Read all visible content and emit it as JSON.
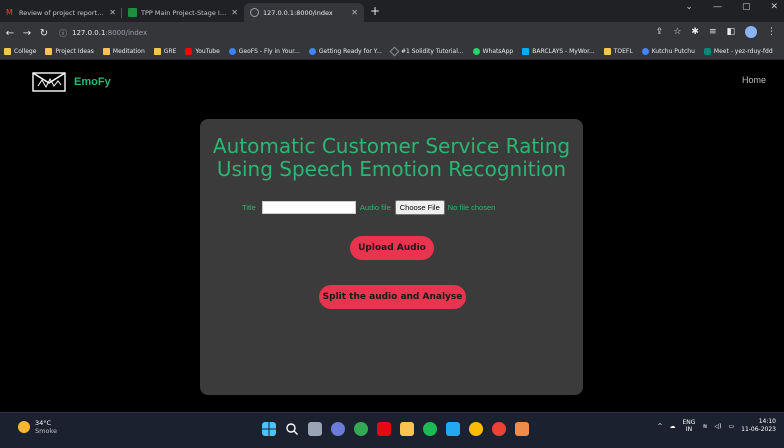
{
  "browser": {
    "tabs": [
      {
        "title": "Review of project report - mihir.",
        "icon": "gmail-icon",
        "color": "#ea4335",
        "active": false
      },
      {
        "title": "TPP Main Project-Stage II- Sem V",
        "icon": "classroom-icon",
        "color": "#1e8e3e",
        "active": false
      },
      {
        "title": "127.0.0.1:8000/index",
        "icon": "globe-icon",
        "color": "#9aa0a6",
        "active": true
      }
    ],
    "new_tab": "+",
    "address": {
      "host": "127.0.0.1",
      "path": ":8000/index"
    },
    "bookmarks": [
      {
        "label": "College",
        "icon": "folder-icon",
        "color": "#f6c44f"
      },
      {
        "label": "Project Ideas",
        "icon": "folder-icon",
        "color": "#f6c44f"
      },
      {
        "label": "Meditation",
        "icon": "folder-icon",
        "color": "#f6c44f"
      },
      {
        "label": "GRE",
        "icon": "folder-icon",
        "color": "#f6c44f"
      },
      {
        "label": "YouTube",
        "icon": "youtube-icon",
        "color": "#ff0000"
      },
      {
        "label": "GeoFS - Fly in Your...",
        "icon": "geofs-icon",
        "color": "#3b82f6"
      },
      {
        "label": "Getting Ready for Y...",
        "icon": "chrome-icon",
        "color": "#4285f4"
      },
      {
        "label": "#1 Solidity Tutorial...",
        "icon": "solidity-icon",
        "color": "#8a8a8a"
      },
      {
        "label": "WhatsApp",
        "icon": "whatsapp-icon",
        "color": "#25d366"
      },
      {
        "label": "BARCLAYS - MyWor...",
        "icon": "barclays-icon",
        "color": "#00aeef"
      },
      {
        "label": "TOEFL",
        "icon": "folder-icon",
        "color": "#f6c44f"
      },
      {
        "label": "Kutchu Putchu",
        "icon": "chrome-icon",
        "color": "#4285f4"
      },
      {
        "label": "Meet - yez-rduy-fdd",
        "icon": "meet-icon",
        "color": "#00897b"
      }
    ]
  },
  "page": {
    "brand": "EmoFy",
    "nav_home": "Home",
    "title_line1": "Automatic Customer Service Rating",
    "title_line2": "Using Speech Emotion Recognition",
    "form": {
      "title_label": "Title",
      "title_value": "",
      "audio_label": "Audio file",
      "choose_button": "Choose File",
      "no_file": "No file chosen"
    },
    "upload_button": "Upload Audio",
    "split_button": "Split the audio and Analyse",
    "accent_color": "#2bb673",
    "button_color": "#e8344f"
  },
  "taskbar": {
    "weather_temp": "34°C",
    "weather_cond": "Smoke",
    "lang_line1": "ENG",
    "lang_line2": "IN",
    "time": "14:10",
    "date": "11-06-2023"
  }
}
